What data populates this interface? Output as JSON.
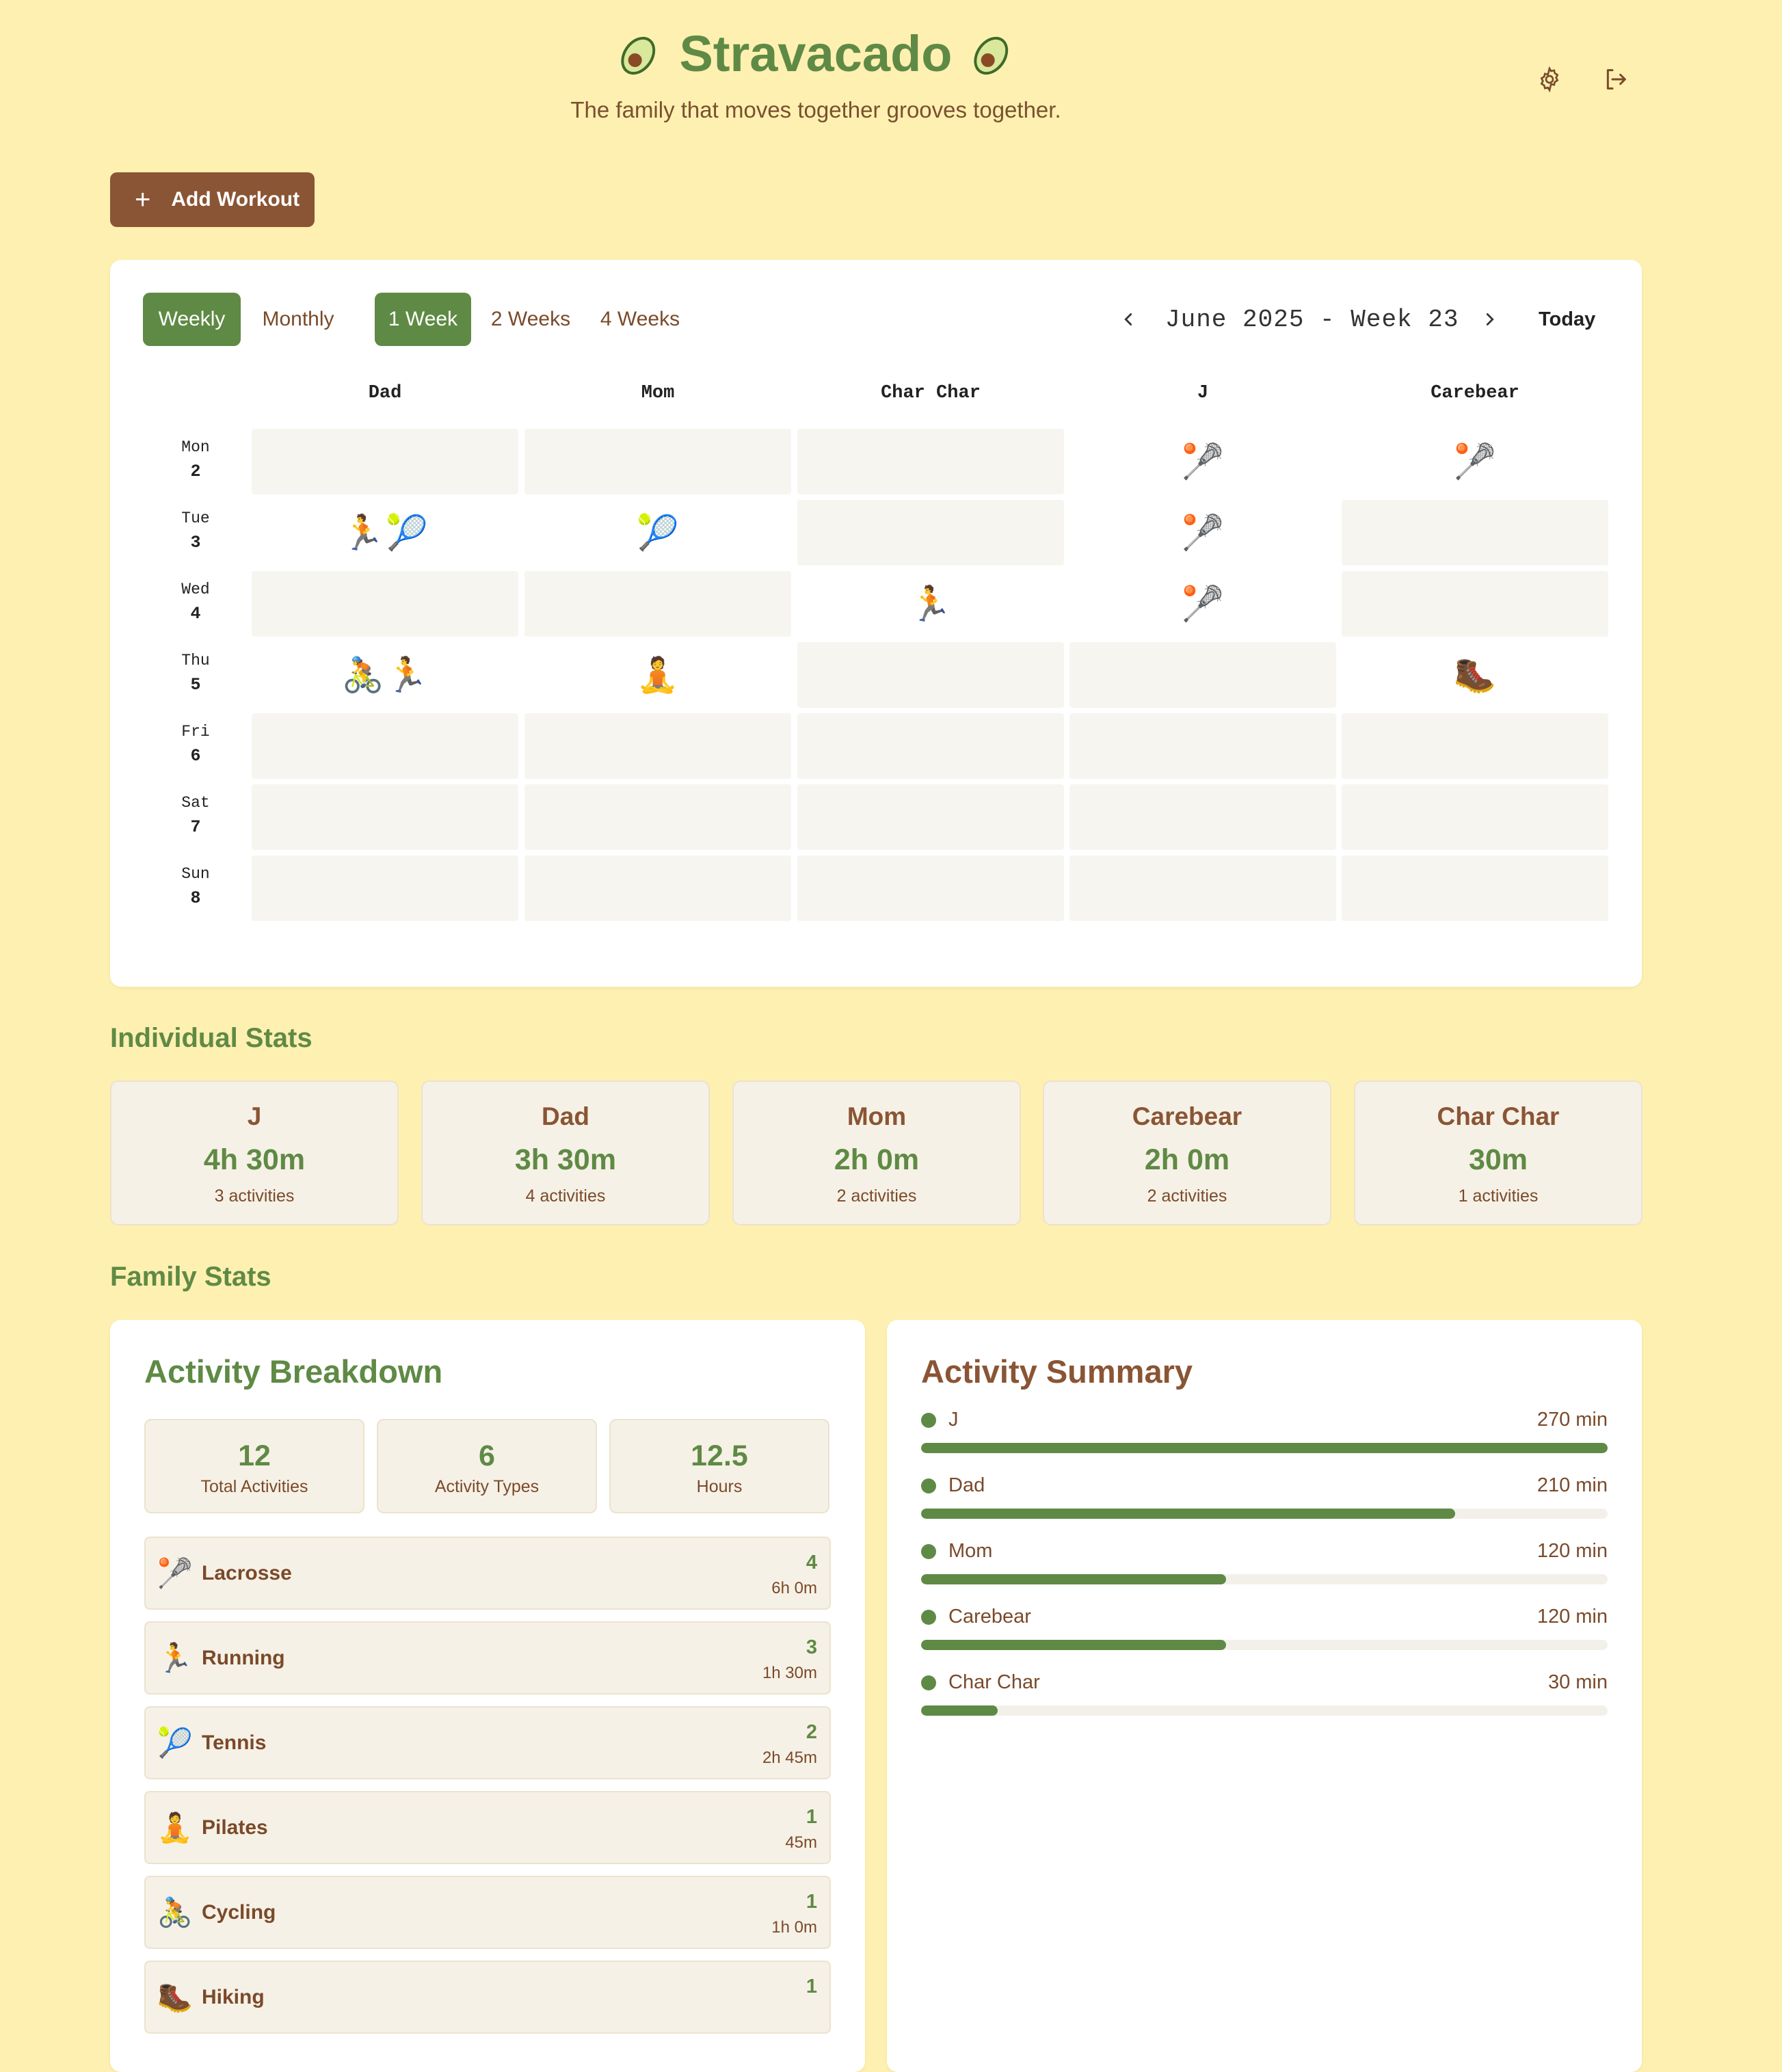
{
  "app": {
    "title": "Stravacado",
    "subtitle": "The family that moves together grooves together.",
    "add_workout_label": "Add Workout"
  },
  "calendar": {
    "view_tabs": [
      {
        "label": "Weekly",
        "active": true
      },
      {
        "label": "Monthly",
        "active": false
      }
    ],
    "range_tabs": [
      {
        "label": "1 Week",
        "active": true
      },
      {
        "label": "2 Weeks",
        "active": false
      },
      {
        "label": "4 Weeks",
        "active": false
      }
    ],
    "period_label": "June 2025 - Week 23",
    "today_label": "Today",
    "members": [
      "Dad",
      "Mom",
      "Char Char",
      "J",
      "Carebear"
    ],
    "days": [
      {
        "name": "Mon",
        "date": "2",
        "cells": [
          [],
          [],
          [],
          [
            "lacrosse"
          ],
          [
            "lacrosse"
          ]
        ]
      },
      {
        "name": "Tue",
        "date": "3",
        "cells": [
          [
            "running",
            "tennis"
          ],
          [
            "tennis"
          ],
          [],
          [
            "lacrosse"
          ],
          []
        ]
      },
      {
        "name": "Wed",
        "date": "4",
        "cells": [
          [],
          [],
          [
            "running"
          ],
          [
            "lacrosse"
          ],
          []
        ]
      },
      {
        "name": "Thu",
        "date": "5",
        "cells": [
          [
            "cycling",
            "running"
          ],
          [
            "pilates"
          ],
          [],
          [],
          [
            "hiking"
          ]
        ]
      },
      {
        "name": "Fri",
        "date": "6",
        "cells": [
          [],
          [],
          [],
          [],
          []
        ]
      },
      {
        "name": "Sat",
        "date": "7",
        "cells": [
          [],
          [],
          [],
          [],
          []
        ]
      },
      {
        "name": "Sun",
        "date": "8",
        "cells": [
          [],
          [],
          [],
          [],
          []
        ]
      }
    ],
    "activity_icons": {
      "lacrosse": "🥍",
      "running": "🏃",
      "tennis": "🎾",
      "cycling": "🚴",
      "pilates": "🧘",
      "hiking": "🥾"
    }
  },
  "individual_stats": {
    "heading": "Individual Stats",
    "cards": [
      {
        "name": "J",
        "time": "4h 30m",
        "activities": "3 activities"
      },
      {
        "name": "Dad",
        "time": "3h 30m",
        "activities": "4 activities"
      },
      {
        "name": "Mom",
        "time": "2h 0m",
        "activities": "2 activities"
      },
      {
        "name": "Carebear",
        "time": "2h 0m",
        "activities": "2 activities"
      },
      {
        "name": "Char Char",
        "time": "30m",
        "activities": "1 activities"
      }
    ]
  },
  "family_stats": {
    "heading": "Family Stats",
    "breakdown": {
      "title": "Activity Breakdown",
      "totals": [
        {
          "value": "12",
          "label": "Total Activities"
        },
        {
          "value": "6",
          "label": "Activity Types"
        },
        {
          "value": "12.5",
          "label": "Hours"
        }
      ],
      "activities": [
        {
          "icon": "lacrosse",
          "name": "Lacrosse",
          "count": "4",
          "duration": "6h 0m"
        },
        {
          "icon": "running",
          "name": "Running",
          "count": "3",
          "duration": "1h 30m"
        },
        {
          "icon": "tennis",
          "name": "Tennis",
          "count": "2",
          "duration": "2h 45m"
        },
        {
          "icon": "pilates",
          "name": "Pilates",
          "count": "1",
          "duration": "45m"
        },
        {
          "icon": "cycling",
          "name": "Cycling",
          "count": "1",
          "duration": "1h 0m"
        },
        {
          "icon": "hiking",
          "name": "Hiking",
          "count": "1",
          "duration": ""
        }
      ]
    },
    "summary": {
      "title": "Activity Summary",
      "rows": [
        {
          "name": "J",
          "minutes": 270,
          "label": "270 min"
        },
        {
          "name": "Dad",
          "minutes": 210,
          "label": "210 min"
        },
        {
          "name": "Mom",
          "minutes": 120,
          "label": "120 min"
        },
        {
          "name": "Carebear",
          "minutes": 120,
          "label": "120 min"
        },
        {
          "name": "Char Char",
          "minutes": 30,
          "label": "30 min"
        }
      ],
      "max_minutes": 270
    }
  },
  "colors": {
    "background": "#fef0b0",
    "accent_green": "#5f8a45",
    "brown": "#8a5535"
  }
}
